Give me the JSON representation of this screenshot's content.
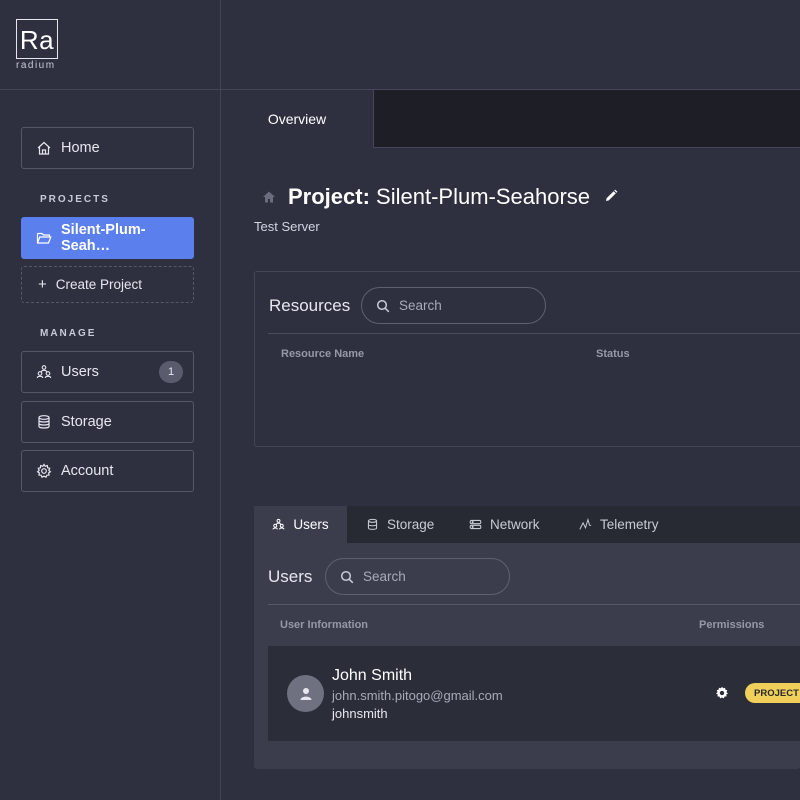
{
  "brand": {
    "logo": "Ra",
    "name": "radium"
  },
  "sidebar": {
    "home_label": "Home",
    "projects_heading": "PROJECTS",
    "active_project": "Silent-Plum-Seah…",
    "create_project": "Create Project",
    "manage_heading": "MANAGE",
    "items": [
      {
        "label": "Users",
        "icon": "users-icon",
        "count": "1"
      },
      {
        "label": "Storage",
        "icon": "database-icon"
      },
      {
        "label": "Account",
        "icon": "gear-icon"
      }
    ],
    "accent_color": "#5b7fec"
  },
  "tabs": {
    "overview": "Overview"
  },
  "project": {
    "title_prefix": "Project:",
    "name": "Silent-Plum-Seahorse",
    "subtitle": "Test Server"
  },
  "resources": {
    "title": "Resources",
    "search_placeholder": "Search",
    "columns": [
      "Resource Name",
      "Status"
    ]
  },
  "bottom_tabs": [
    {
      "label": "Users",
      "icon": "users-icon",
      "active": true
    },
    {
      "label": "Storage",
      "icon": "database-icon"
    },
    {
      "label": "Network",
      "icon": "server-icon"
    },
    {
      "label": "Telemetry",
      "icon": "telemetry-icon"
    }
  ],
  "users_panel": {
    "title": "Users",
    "search_placeholder": "Search",
    "columns": [
      "User Information",
      "Permissions"
    ],
    "rows": [
      {
        "name": "John Smith",
        "email": "john.smith.pitogo@gmail.com",
        "username": "johnsmith",
        "role": "PROJECT A",
        "role_color": "#f1cf5b"
      }
    ]
  }
}
